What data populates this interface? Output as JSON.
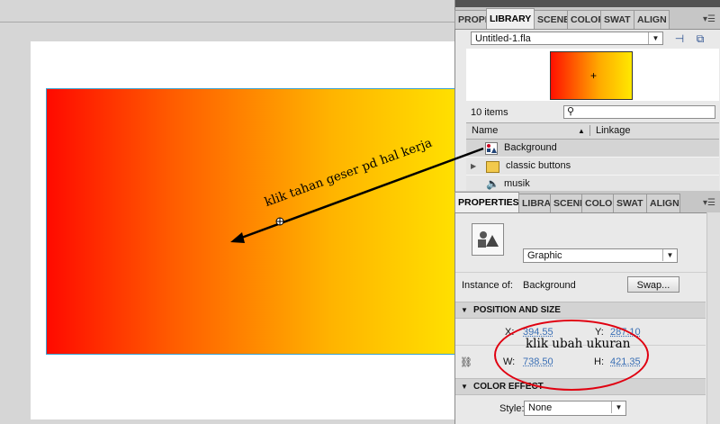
{
  "library": {
    "tabs": [
      "PROPE",
      "LIBRARY",
      "SCENE",
      "COLOR",
      "SWAT",
      "ALIGN"
    ],
    "active_tab": "LIBRARY",
    "document": "Untitled-1.fla",
    "items_count": "10 items",
    "search_placeholder": "",
    "columns": {
      "name": "Name",
      "linkage": "Linkage"
    },
    "items": [
      {
        "name": "Background",
        "icon": "graphic-symbol-icon",
        "selected": true
      },
      {
        "name": "classic buttons",
        "icon": "folder-icon",
        "selected": false
      },
      {
        "name": "musik",
        "icon": "sound-icon",
        "selected": false
      }
    ]
  },
  "properties": {
    "tabs": [
      "PROPERTIES",
      "LIBRA",
      "SCENE",
      "COLO",
      "SWAT",
      "ALIGN"
    ],
    "active_tab": "PROPERTIES",
    "symbol_type": "Graphic",
    "instance_label": "Instance of:",
    "instance_value": "Background",
    "swap_label": "Swap...",
    "position_section": "POSITION AND SIZE",
    "x_label": "X:",
    "x_value": "394.55",
    "y_label": "Y:",
    "y_value": "287.10",
    "w_label": "W:",
    "w_value": "738.50",
    "h_label": "H:",
    "h_value": "421.35",
    "color_section": "COLOR EFFECT",
    "style_label": "Style:",
    "style_value": "None"
  },
  "annotations": {
    "drag_note": "klik tahan geser pd hal kerja",
    "resize_note": "klik ubah ukuran"
  },
  "colors": {
    "gradient_start": "#ff0a00",
    "gradient_end": "#ffe000",
    "annotation_red": "#e00010",
    "link_blue": "#3a6fb5"
  }
}
